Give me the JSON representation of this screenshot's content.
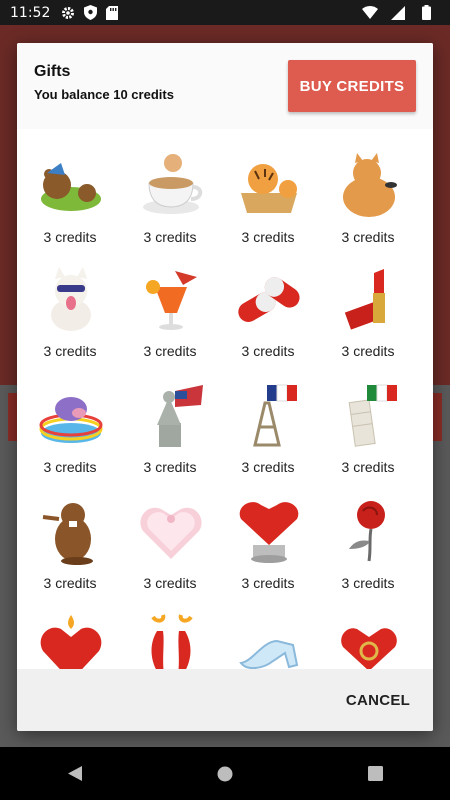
{
  "status_bar": {
    "time": "11:52"
  },
  "dialog": {
    "title": "Gifts",
    "balance": "You balance 10 credits",
    "buy_label": "BUY CREDITS",
    "cancel_label": "CANCEL"
  },
  "gifts": [
    {
      "name": "sleeping-bear",
      "price": "3 credits"
    },
    {
      "name": "coffee-cup",
      "price": "3 credits"
    },
    {
      "name": "tiger-basket",
      "price": "3 credits"
    },
    {
      "name": "fat-cat",
      "price": "3 credits"
    },
    {
      "name": "cool-dog",
      "price": "3 credits"
    },
    {
      "name": "cocktail",
      "price": "3 credits"
    },
    {
      "name": "pills",
      "price": "3 credits"
    },
    {
      "name": "lipstick",
      "price": "3 credits"
    },
    {
      "name": "hippo-pool",
      "price": "3 credits"
    },
    {
      "name": "statue-of-liberty",
      "price": "3 credits"
    },
    {
      "name": "eiffel-tower",
      "price": "3 credits"
    },
    {
      "name": "leaning-tower",
      "price": "3 credits"
    },
    {
      "name": "beaver",
      "price": "3 credits"
    },
    {
      "name": "heart-cake",
      "price": "3 credits"
    },
    {
      "name": "cherry-pie",
      "price": "3 credits"
    },
    {
      "name": "red-rose",
      "price": "3 credits"
    },
    {
      "name": "heart-candle",
      "price": ""
    },
    {
      "name": "hot-peppers",
      "price": ""
    },
    {
      "name": "glass-slipper",
      "price": ""
    },
    {
      "name": "ring-box",
      "price": ""
    }
  ]
}
